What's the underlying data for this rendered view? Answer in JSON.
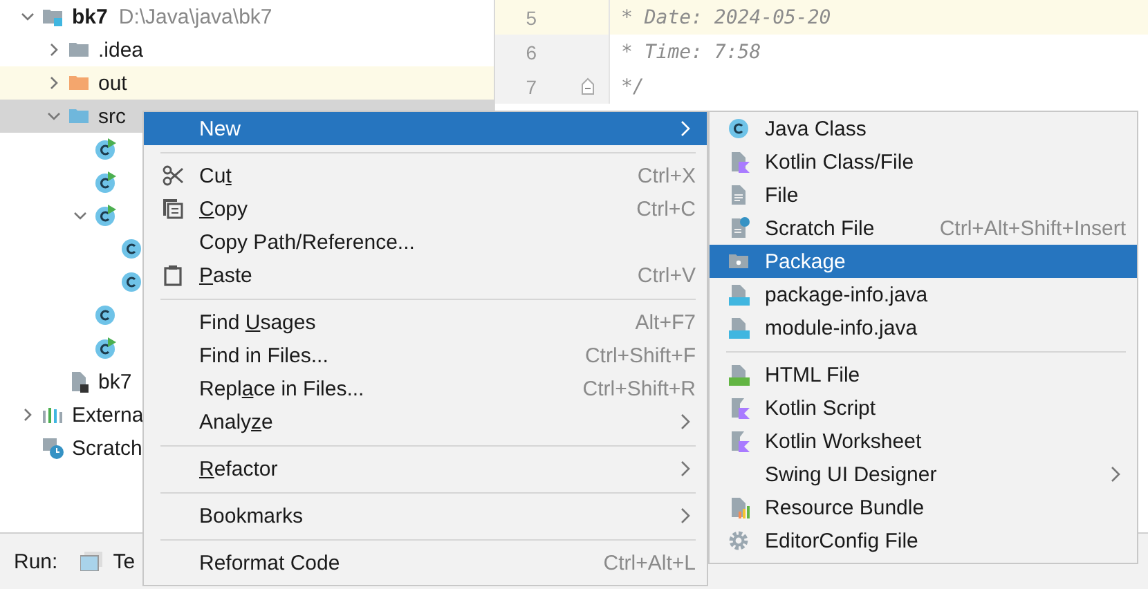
{
  "project_tree": {
    "items": [
      {
        "label": "bk7",
        "path": "D:\\Java\\java\\bk7",
        "kind": "module",
        "expanded": true,
        "selected": false,
        "highlighted": false,
        "children": [
          {
            "label": ".idea",
            "kind": "folder",
            "expanded": false,
            "selected": false,
            "highlighted": false
          },
          {
            "label": "out",
            "kind": "folder-excluded",
            "expanded": false,
            "selected": false,
            "highlighted": true
          },
          {
            "label": "src",
            "kind": "folder-source",
            "expanded": true,
            "selected": true,
            "highlighted": false,
            "children": [
              {
                "kind": "class-run",
                "selected": false,
                "highlighted": false
              },
              {
                "kind": "class-run",
                "selected": false,
                "highlighted": false
              },
              {
                "kind": "class-run",
                "expanded": true,
                "selected": false,
                "highlighted": false,
                "children": [
                  {
                    "kind": "class",
                    "selected": false,
                    "highlighted": false
                  },
                  {
                    "kind": "class",
                    "selected": false,
                    "highlighted": false
                  }
                ]
              },
              {
                "kind": "class",
                "selected": false,
                "highlighted": false
              },
              {
                "kind": "class-run",
                "selected": false,
                "highlighted": false
              }
            ]
          },
          {
            "label": "bk7",
            "kind": "iml",
            "selected": false,
            "highlighted": false
          }
        ]
      },
      {
        "label": "Externa",
        "kind": "libraries",
        "expanded": false,
        "selected": false,
        "highlighted": false
      },
      {
        "label": "Scratch",
        "kind": "scratches",
        "selected": false,
        "highlighted": false
      }
    ]
  },
  "editor": {
    "lines": [
      {
        "number": "5",
        "text": "* Date: 2024-05-20",
        "current": true,
        "fold_marker": false
      },
      {
        "number": "6",
        "text": "* Time: 7:58",
        "current": false,
        "fold_marker": false
      },
      {
        "number": "7",
        "text": "*/",
        "current": false,
        "fold_marker": true
      }
    ]
  },
  "run_bar": {
    "label": "Run:",
    "tabs": [
      {
        "label": "Te"
      }
    ]
  },
  "context_menu": {
    "groups": [
      [
        {
          "label": "New",
          "kind": "none",
          "selected": true,
          "has_submenu": true
        }
      ],
      [
        {
          "label": "Cu",
          "kind": "cut",
          "mnemonic": "t",
          "shortcut": "Ctrl+X",
          "selected": false,
          "has_submenu": false
        },
        {
          "mnemonic": "C",
          "label_rest": "opy",
          "kind": "copy",
          "shortcut": "Ctrl+C",
          "selected": false,
          "has_submenu": false
        },
        {
          "label": "Copy Path/Reference...",
          "kind": "none",
          "selected": false,
          "has_submenu": false
        },
        {
          "mnemonic": "P",
          "label_rest": "aste",
          "kind": "paste",
          "shortcut": "Ctrl+V",
          "selected": false,
          "has_submenu": false
        }
      ],
      [
        {
          "label": "Find ",
          "mnemonic": "U",
          "label_rest": "sages",
          "kind": "none",
          "shortcut": "Alt+F7",
          "selected": false,
          "has_submenu": false
        },
        {
          "label": "Find in Files...",
          "kind": "none",
          "shortcut": "Ctrl+Shift+F",
          "selected": false,
          "has_submenu": false
        },
        {
          "label": "Repl",
          "mnemonic": "a",
          "label_rest": "ce in Files...",
          "kind": "none",
          "shortcut": "Ctrl+Shift+R",
          "selected": false,
          "has_submenu": false
        },
        {
          "label": "Analy",
          "mnemonic": "z",
          "label_rest": "e",
          "kind": "none",
          "selected": false,
          "has_submenu": true
        }
      ],
      [
        {
          "mnemonic": "R",
          "label_rest": "efactor",
          "kind": "none",
          "selected": false,
          "has_submenu": true
        }
      ],
      [
        {
          "label": "Bookmarks",
          "kind": "none",
          "selected": false,
          "has_submenu": true
        }
      ],
      [
        {
          "label": "Reformat Code",
          "kind": "none",
          "shortcut": "Ctrl+Alt+L",
          "selected": false,
          "has_submenu": false
        }
      ]
    ]
  },
  "submenu": {
    "groups": [
      [
        {
          "label": "Java Class",
          "kind": "class",
          "selected": false,
          "has_submenu": false
        },
        {
          "label": "Kotlin Class/File",
          "kind": "kotlin",
          "selected": false,
          "has_submenu": false
        },
        {
          "label": "File",
          "kind": "file",
          "selected": false,
          "has_submenu": false
        },
        {
          "label": "Scratch File",
          "kind": "scratch",
          "shortcut": "Ctrl+Alt+Shift+Insert",
          "selected": false,
          "has_submenu": false
        },
        {
          "label": "Package",
          "kind": "package",
          "selected": true,
          "has_submenu": false
        },
        {
          "label": "package-info.java",
          "kind": "java-file",
          "selected": false,
          "has_submenu": false
        },
        {
          "label": "module-info.java",
          "kind": "java-file",
          "selected": false,
          "has_submenu": false
        }
      ],
      [
        {
          "label": "HTML File",
          "kind": "html",
          "selected": false,
          "has_submenu": false
        },
        {
          "label": "Kotlin Script",
          "kind": "kotlin-script",
          "selected": false,
          "has_submenu": false
        },
        {
          "label": "Kotlin Worksheet",
          "kind": "kotlin-script",
          "selected": false,
          "has_submenu": false
        },
        {
          "label": "Swing UI Designer",
          "kind": "none",
          "selected": false,
          "has_submenu": true
        },
        {
          "label": "Resource Bundle",
          "kind": "bundle",
          "selected": false,
          "has_submenu": false
        },
        {
          "label": "EditorConfig File",
          "kind": "gear",
          "selected": false,
          "has_submenu": false
        }
      ]
    ]
  }
}
